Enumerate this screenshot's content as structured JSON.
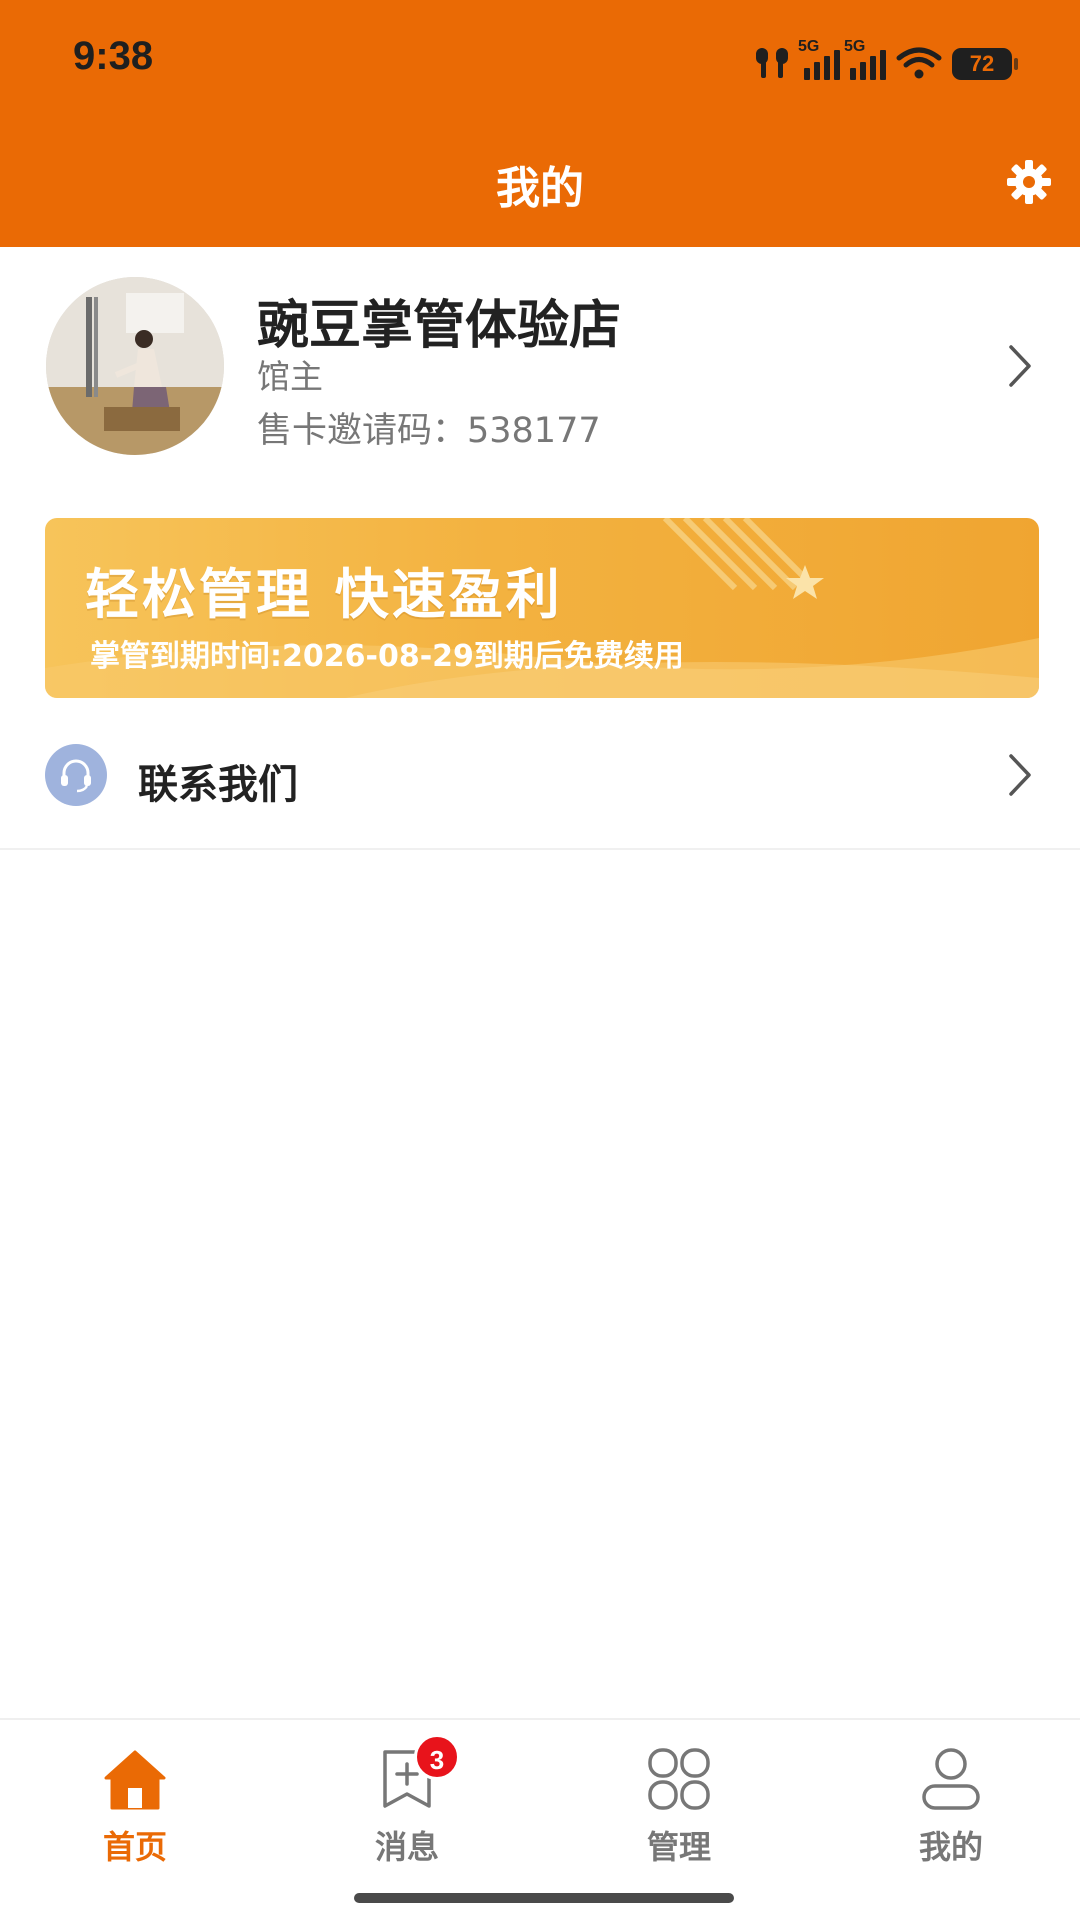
{
  "status_bar": {
    "time": "9:38",
    "network_1": "5G",
    "network_2": "5G",
    "battery": "72"
  },
  "header": {
    "title": "我的",
    "settings_icon": "gear-icon"
  },
  "profile": {
    "store_name": "豌豆掌管体验店",
    "role": "馆主",
    "invite_code_text": "售卡邀请码：538177"
  },
  "banner": {
    "title": "轻松管理 快速盈利",
    "subtitle": "掌管到期时间:2026-08-29到期后免费续用"
  },
  "menu": {
    "contact_label": "联系我们",
    "contact_icon": "headset-icon"
  },
  "tabs": [
    {
      "label": "首页",
      "icon": "home-icon",
      "active": true
    },
    {
      "label": "消息",
      "icon": "message-icon",
      "badge": "3"
    },
    {
      "label": "管理",
      "icon": "grid-icon"
    },
    {
      "label": "我的",
      "icon": "person-icon"
    }
  ],
  "colors": {
    "brand": "#EA6A05",
    "badge": "#E8131B",
    "banner": "#F3B240"
  }
}
